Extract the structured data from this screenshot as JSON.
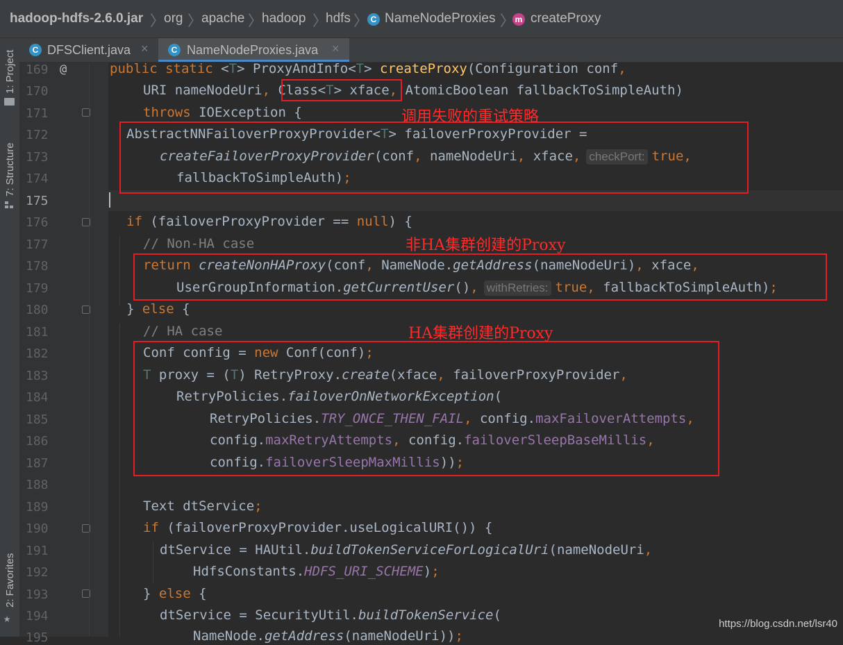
{
  "breadcrumb": {
    "items": [
      "hadoop-hdfs-2.6.0.jar",
      "org",
      "apache",
      "hadoop",
      "hdfs",
      "NameNodeProxies",
      "createProxy"
    ],
    "sep": "〉",
    "class_icon": "C",
    "method_icon": "m"
  },
  "tabs": [
    {
      "label": "DFSClient.java",
      "icon": "C",
      "close": "×"
    },
    {
      "label": "NameNodeProxies.java",
      "icon": "C",
      "close": "×"
    }
  ],
  "sidebar": {
    "project": "1: Project",
    "structure": "7: Structure",
    "favorites": "2: Favorites"
  },
  "gutter": {
    "override_mark": "@",
    "line_numbers": [
      "169",
      "170",
      "171",
      "172",
      "173",
      "174",
      "175",
      "176",
      "177",
      "178",
      "179",
      "180",
      "181",
      "182",
      "183",
      "184",
      "185",
      "186",
      "187",
      "188",
      "189",
      "190",
      "191",
      "192",
      "193",
      "194",
      "195"
    ]
  },
  "hints": {
    "check_port": "checkPort:",
    "with_retries": "withRetries:"
  },
  "annotations": {
    "retry_policy": "调用失败的重试策略",
    "non_ha_proxy": "非HA集群创建的Proxy",
    "ha_proxy": "HA集群创建的Proxy"
  },
  "watermark": "https://blog.csdn.net/lsr40",
  "colors": {
    "editor_bg": "#2b2b2b",
    "keyword": "#cc7832",
    "annotation_red": "#e51c23",
    "field": "#9876aa",
    "tab_accent": "#4a88c7"
  }
}
